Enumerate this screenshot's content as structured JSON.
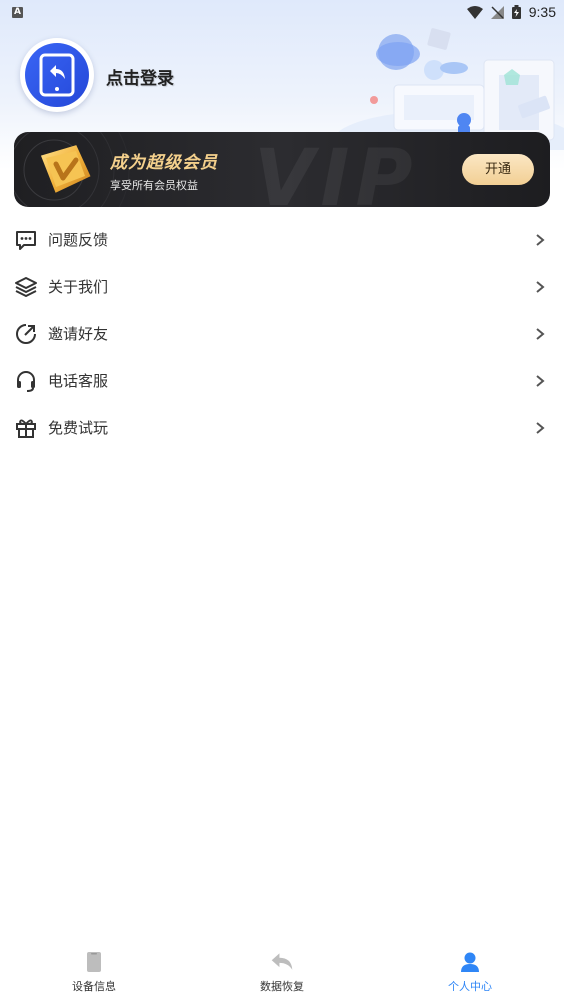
{
  "status_bar": {
    "left_icon_letter": "A",
    "time": "9:35",
    "icons": [
      "wifi-icon",
      "signal-off-icon",
      "battery-charging-icon"
    ]
  },
  "profile": {
    "avatar_icon": "phone-restore-icon",
    "login_label": "点击登录"
  },
  "vip": {
    "title": "成为超级会员",
    "subtitle": "享受所有会员权益",
    "button_label": "开通",
    "watermark": "VIP",
    "badge_icon": "vip-badge-icon",
    "accent_color": "#f4d08c"
  },
  "menu": {
    "items": [
      {
        "label": "问题反馈",
        "icon": "feedback-icon"
      },
      {
        "label": "关于我们",
        "icon": "layers-icon"
      },
      {
        "label": "邀请好友",
        "icon": "share-icon"
      },
      {
        "label": "电话客服",
        "icon": "headset-icon"
      },
      {
        "label": "免费试玩",
        "icon": "gift-icon"
      }
    ]
  },
  "bottom_nav": {
    "items": [
      {
        "label": "设备信息",
        "icon": "device-icon",
        "active": false
      },
      {
        "label": "数据恢复",
        "icon": "restore-icon",
        "active": false
      },
      {
        "label": "个人中心",
        "icon": "user-icon",
        "active": true
      }
    ],
    "active_color": "#2f86f6"
  }
}
